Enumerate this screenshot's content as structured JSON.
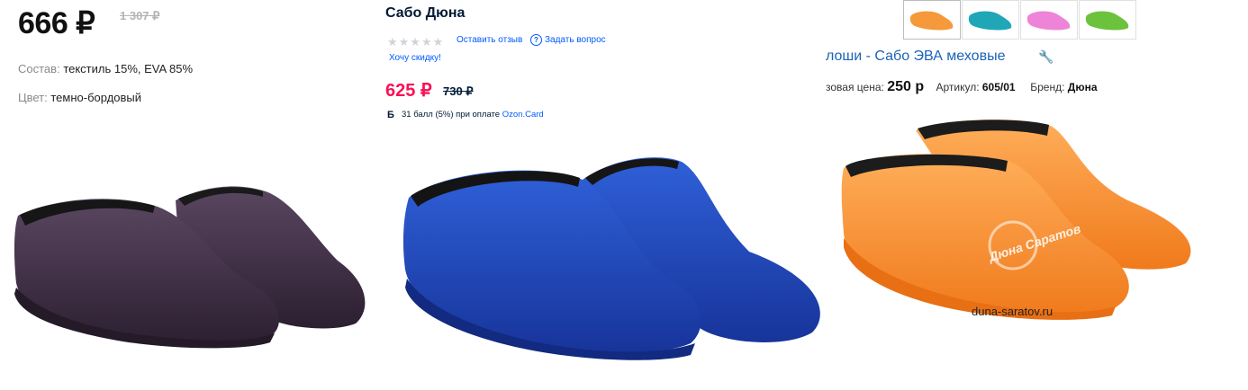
{
  "panel1": {
    "price": "666 ₽",
    "old_price": "1 307 ₽",
    "composition_key": "Состав:",
    "composition_value": "текстиль 15%, EVA 85%",
    "color_key": "Цвет:",
    "color_value": "темно-бордовый",
    "product_color": "#3b2a3e"
  },
  "panel2": {
    "title": "Сабо Дюна",
    "stars": "★★★★★",
    "review_link": "Оставить отзыв",
    "ask_link": "Задать вопрос",
    "discount_link": "Хочу скидку!",
    "price": "625 ₽",
    "old_price": "730 ₽",
    "bonus_icon": "Б",
    "bonus_text": "31 балл (5%) при оплате",
    "bonus_card": "Ozon.Card",
    "product_color": "#1f46b8",
    "accent_color": "#f91155",
    "link_color": "#005bff"
  },
  "panel3": {
    "thumbnails": [
      {
        "name": "orange",
        "color": "#f5993a"
      },
      {
        "name": "teal",
        "color": "#1fa7b8"
      },
      {
        "name": "pink",
        "color": "#ee84d8"
      },
      {
        "name": "green",
        "color": "#6cc23c"
      }
    ],
    "title": "лоши - Сабо ЭВА меховые",
    "price_label": "зовая цена:",
    "price_value": "250 р",
    "article_label": "Артикул:",
    "article_value": "605/01",
    "brand_label": "Бренд:",
    "brand_value": "Дюна",
    "watermark_text": "Дюна Саратов",
    "site": "duna-saratov.ru",
    "product_color": "#f7953e"
  }
}
